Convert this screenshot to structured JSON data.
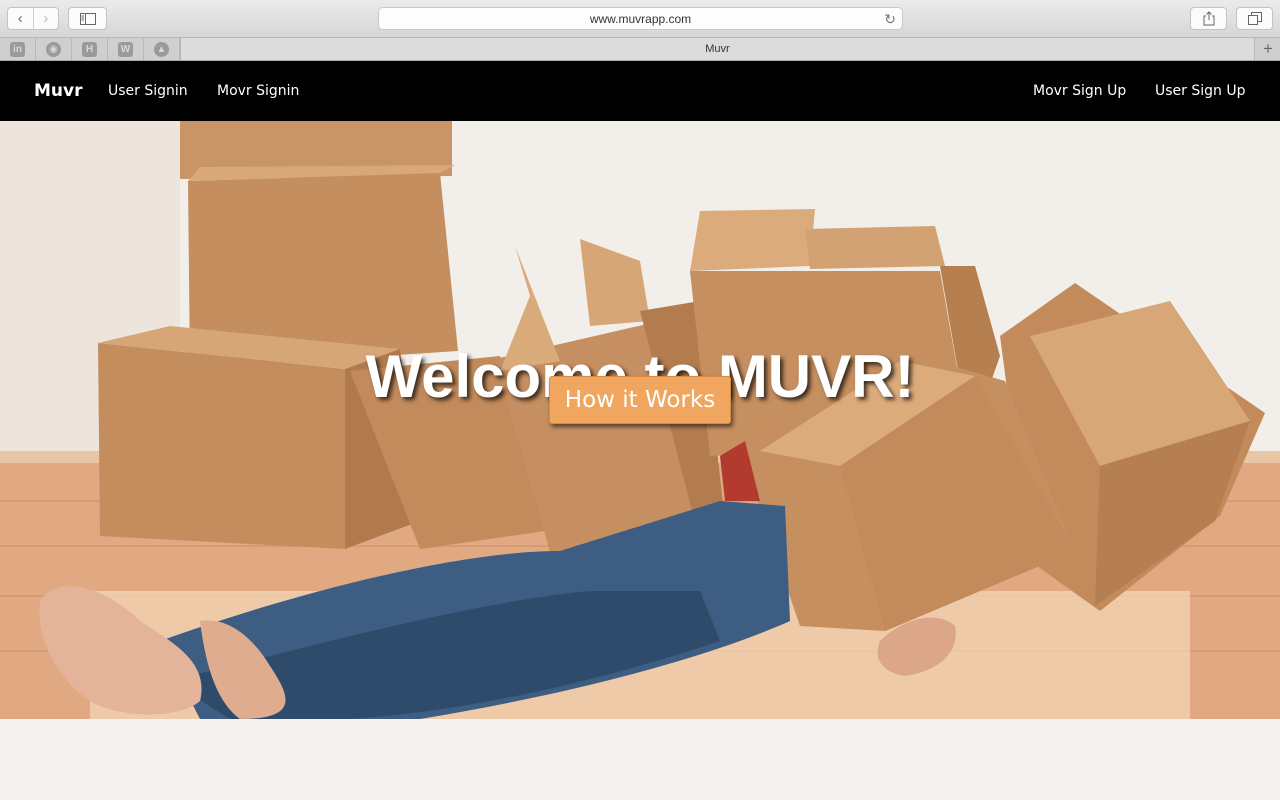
{
  "browser": {
    "url": "www.muvrapp.com",
    "tab_title": "Muvr",
    "favorites": [
      {
        "icon": "linkedin-icon",
        "glyph": "in"
      },
      {
        "icon": "github-icon",
        "glyph": "◉"
      },
      {
        "icon": "hacker-icon",
        "glyph": "H"
      },
      {
        "icon": "wikipedia-icon",
        "glyph": "W"
      },
      {
        "icon": "drive-icon",
        "glyph": "▲"
      }
    ],
    "back_glyph": "‹",
    "forward_glyph": "›",
    "new_tab_glyph": "+",
    "reload_glyph": "↻"
  },
  "navbar": {
    "brand": "Muvr",
    "links_left": [
      "User Signin",
      "Movr Signin"
    ],
    "links_right": [
      "Movr Sign Up",
      "User Sign Up"
    ]
  },
  "hero": {
    "title": "Welcome to MUVR!",
    "button_label": "How it Works"
  },
  "colors": {
    "navbar_bg": "#000000",
    "cta_bg": "#f0a65e",
    "page_bg": "#f4f3ef"
  }
}
